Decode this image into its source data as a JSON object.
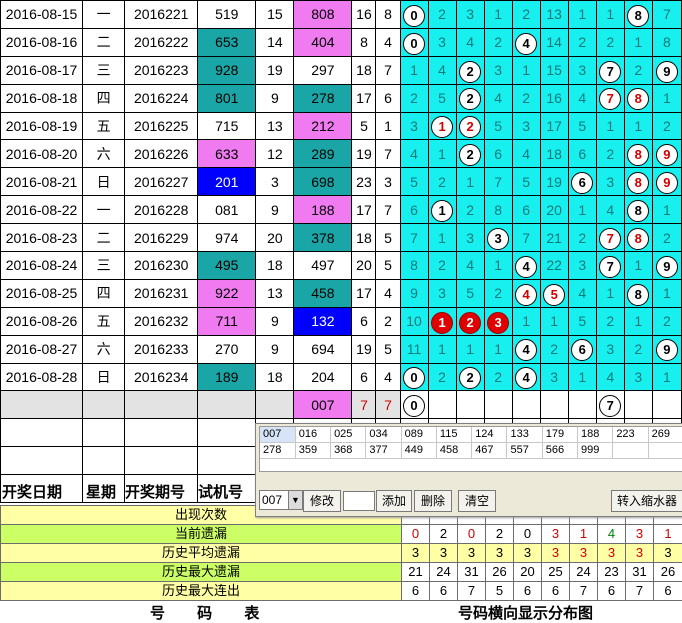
{
  "rows": [
    {
      "date": "2016-08-15",
      "weekday": "一",
      "period": "2016221",
      "trial": "519",
      "sum": "15",
      "draw": "808",
      "c1": "16",
      "c2": "8",
      "cells": [
        [
          "0",
          "b"
        ],
        [
          "2",
          ""
        ],
        [
          "3",
          ""
        ],
        [
          "1",
          ""
        ],
        [
          "2",
          ""
        ],
        [
          "13",
          ""
        ],
        [
          "1",
          ""
        ],
        [
          "1",
          ""
        ],
        [
          "8",
          "b"
        ],
        [
          "7",
          ""
        ]
      ]
    },
    {
      "date": "2016-08-16",
      "weekday": "二",
      "period": "2016222",
      "trial": "653",
      "sum": "14",
      "draw": "404",
      "c1": "8",
      "c2": "4",
      "cells": [
        [
          "0",
          "b"
        ],
        [
          "3",
          ""
        ],
        [
          "4",
          ""
        ],
        [
          "2",
          ""
        ],
        [
          "4",
          "b"
        ],
        [
          "14",
          ""
        ],
        [
          "2",
          ""
        ],
        [
          "2",
          ""
        ],
        [
          "1",
          ""
        ],
        [
          "8",
          ""
        ]
      ]
    },
    {
      "date": "2016-08-17",
      "weekday": "三",
      "period": "2016223",
      "trial": "928",
      "sum": "19",
      "draw": "297",
      "c1": "18",
      "c2": "7",
      "cells": [
        [
          "1",
          ""
        ],
        [
          "4",
          ""
        ],
        [
          "2",
          "b"
        ],
        [
          "3",
          ""
        ],
        [
          "1",
          ""
        ],
        [
          "15",
          ""
        ],
        [
          "3",
          ""
        ],
        [
          "7",
          "b"
        ],
        [
          "2",
          ""
        ],
        [
          "9",
          "b"
        ]
      ]
    },
    {
      "date": "2016-08-18",
      "weekday": "四",
      "period": "2016224",
      "trial": "801",
      "sum": "9",
      "draw": "278",
      "c1": "17",
      "c2": "6",
      "cells": [
        [
          "2",
          ""
        ],
        [
          "5",
          ""
        ],
        [
          "2",
          "b"
        ],
        [
          "4",
          ""
        ],
        [
          "2",
          ""
        ],
        [
          "16",
          ""
        ],
        [
          "4",
          ""
        ],
        [
          "7",
          "r"
        ],
        [
          "8",
          "r"
        ],
        [
          "1",
          ""
        ]
      ]
    },
    {
      "date": "2016-08-19",
      "weekday": "五",
      "period": "2016225",
      "trial": "715",
      "sum": "13",
      "draw": "212",
      "c1": "5",
      "c2": "1",
      "cells": [
        [
          "3",
          ""
        ],
        [
          "1",
          "r"
        ],
        [
          "2",
          "r"
        ],
        [
          "5",
          ""
        ],
        [
          "3",
          ""
        ],
        [
          "17",
          ""
        ],
        [
          "5",
          ""
        ],
        [
          "1",
          ""
        ],
        [
          "1",
          ""
        ],
        [
          "2",
          ""
        ]
      ]
    },
    {
      "date": "2016-08-20",
      "weekday": "六",
      "period": "2016226",
      "trial": "633",
      "sum": "12",
      "draw": "289",
      "c1": "19",
      "c2": "7",
      "cells": [
        [
          "4",
          ""
        ],
        [
          "1",
          ""
        ],
        [
          "2",
          "b"
        ],
        [
          "6",
          ""
        ],
        [
          "4",
          ""
        ],
        [
          "18",
          ""
        ],
        [
          "6",
          ""
        ],
        [
          "2",
          ""
        ],
        [
          "8",
          "r"
        ],
        [
          "9",
          "r"
        ]
      ]
    },
    {
      "date": "2016-08-21",
      "weekday": "日",
      "period": "2016227",
      "trial": "201",
      "sum": "3",
      "draw": "698",
      "c1": "23",
      "c2": "3",
      "cells": [
        [
          "5",
          ""
        ],
        [
          "2",
          ""
        ],
        [
          "1",
          ""
        ],
        [
          "7",
          ""
        ],
        [
          "5",
          ""
        ],
        [
          "19",
          ""
        ],
        [
          "6",
          "b"
        ],
        [
          "3",
          ""
        ],
        [
          "8",
          "r"
        ],
        [
          "9",
          "r"
        ]
      ]
    },
    {
      "date": "2016-08-22",
      "weekday": "一",
      "period": "2016228",
      "trial": "081",
      "sum": "9",
      "draw": "188",
      "c1": "17",
      "c2": "7",
      "cells": [
        [
          "6",
          ""
        ],
        [
          "1",
          "b"
        ],
        [
          "2",
          ""
        ],
        [
          "8",
          ""
        ],
        [
          "6",
          ""
        ],
        [
          "20",
          ""
        ],
        [
          "1",
          ""
        ],
        [
          "4",
          ""
        ],
        [
          "8",
          "b"
        ],
        [
          "1",
          ""
        ]
      ]
    },
    {
      "date": "2016-08-23",
      "weekday": "二",
      "period": "2016229",
      "trial": "974",
      "sum": "20",
      "draw": "378",
      "c1": "18",
      "c2": "5",
      "cells": [
        [
          "7",
          ""
        ],
        [
          "1",
          ""
        ],
        [
          "3",
          ""
        ],
        [
          "3",
          "b"
        ],
        [
          "7",
          ""
        ],
        [
          "21",
          ""
        ],
        [
          "2",
          ""
        ],
        [
          "7",
          "r"
        ],
        [
          "8",
          "r"
        ],
        [
          "2",
          ""
        ]
      ]
    },
    {
      "date": "2016-08-24",
      "weekday": "三",
      "period": "2016230",
      "trial": "495",
      "sum": "18",
      "draw": "497",
      "c1": "20",
      "c2": "5",
      "cells": [
        [
          "8",
          ""
        ],
        [
          "2",
          ""
        ],
        [
          "4",
          ""
        ],
        [
          "1",
          ""
        ],
        [
          "4",
          "b"
        ],
        [
          "22",
          ""
        ],
        [
          "3",
          ""
        ],
        [
          "7",
          "b"
        ],
        [
          "1",
          ""
        ],
        [
          "9",
          "b"
        ]
      ]
    },
    {
      "date": "2016-08-25",
      "weekday": "四",
      "period": "2016231",
      "trial": "922",
      "sum": "13",
      "draw": "458",
      "c1": "17",
      "c2": "4",
      "cells": [
        [
          "9",
          ""
        ],
        [
          "3",
          ""
        ],
        [
          "5",
          ""
        ],
        [
          "2",
          ""
        ],
        [
          "4",
          "r"
        ],
        [
          "5",
          "r"
        ],
        [
          "4",
          ""
        ],
        [
          "1",
          ""
        ],
        [
          "8",
          "b"
        ],
        [
          "1",
          ""
        ]
      ]
    },
    {
      "date": "2016-08-26",
      "weekday": "五",
      "period": "2016232",
      "trial": "711",
      "sum": "9",
      "draw": "132",
      "c1": "6",
      "c2": "2",
      "cells": [
        [
          "10",
          ""
        ],
        [
          "1",
          "f"
        ],
        [
          "2",
          "f"
        ],
        [
          "3",
          "f"
        ],
        [
          "1",
          ""
        ],
        [
          "1",
          ""
        ],
        [
          "5",
          ""
        ],
        [
          "2",
          ""
        ],
        [
          "1",
          ""
        ],
        [
          "2",
          ""
        ]
      ]
    },
    {
      "date": "2016-08-27",
      "weekday": "六",
      "period": "2016233",
      "trial": "270",
      "sum": "9",
      "draw": "694",
      "c1": "19",
      "c2": "5",
      "cells": [
        [
          "11",
          ""
        ],
        [
          "1",
          ""
        ],
        [
          "1",
          ""
        ],
        [
          "1",
          ""
        ],
        [
          "4",
          "b"
        ],
        [
          "2",
          ""
        ],
        [
          "6",
          "b"
        ],
        [
          "3",
          ""
        ],
        [
          "2",
          ""
        ],
        [
          "9",
          "b"
        ]
      ]
    },
    {
      "date": "2016-08-28",
      "weekday": "日",
      "period": "2016234",
      "trial": "189",
      "sum": "18",
      "draw": "204",
      "c1": "6",
      "c2": "4",
      "cells": [
        [
          "0",
          "b"
        ],
        [
          "2",
          ""
        ],
        [
          "2",
          "b"
        ],
        [
          "2",
          ""
        ],
        [
          "4",
          "b"
        ],
        [
          "3",
          ""
        ],
        [
          "1",
          ""
        ],
        [
          "4",
          ""
        ],
        [
          "3",
          ""
        ],
        [
          "1",
          ""
        ]
      ]
    }
  ],
  "row_bg": {
    "trial": [
      "",
      "teal",
      "teal",
      "teal",
      "",
      "pink",
      "blue",
      "",
      "",
      "teal",
      "pink",
      "pink",
      "",
      "teal"
    ],
    "draw": [
      "pink",
      "pink",
      "",
      "teal",
      "pink",
      "teal",
      "teal",
      "pink",
      "teal",
      "",
      "teal",
      "blue",
      "",
      ""
    ]
  },
  "pending_row": {
    "draw": "007",
    "c1": "7",
    "c2": "7",
    "ball_first": "0",
    "ball_eighth": "7"
  },
  "headers": {
    "date": "开奖日期",
    "weekday": "星期",
    "period": "开奖期号",
    "trial": "试机号"
  },
  "stats": {
    "labels": [
      "出现次数",
      "当前遗漏",
      "历史平均遗漏",
      "历史最大遗漏",
      "历史最大连出"
    ],
    "current_missing": [
      "0",
      "2",
      "0",
      "2",
      "0",
      "3",
      "1",
      "4",
      "3",
      "1"
    ],
    "avg_missing": [
      "3",
      "3",
      "3",
      "3",
      "3",
      "3",
      "3",
      "3",
      "3",
      "3"
    ],
    "max_missing": [
      "21",
      "24",
      "31",
      "26",
      "20",
      "25",
      "24",
      "23",
      "31",
      "26"
    ],
    "max_consecutive": [
      "6",
      "6",
      "7",
      "5",
      "6",
      "6",
      "7",
      "6",
      "7",
      "6"
    ]
  },
  "footer": {
    "left": "号 码 表",
    "right": "号码横向显示分布图"
  },
  "panel": {
    "numbers_row1": [
      "007",
      "016",
      "025",
      "034",
      "089",
      "115",
      "124",
      "133",
      "179",
      "188",
      "223",
      "269"
    ],
    "numbers_row2": [
      "278",
      "359",
      "368",
      "377",
      "449",
      "458",
      "467",
      "557",
      "566",
      "999",
      "",
      ""
    ],
    "combo_value": "007",
    "modify_label": "修改",
    "add_label": "添加",
    "delete_label": "删除",
    "clear_label": "清空",
    "transfer_label": "转入缩水器"
  }
}
